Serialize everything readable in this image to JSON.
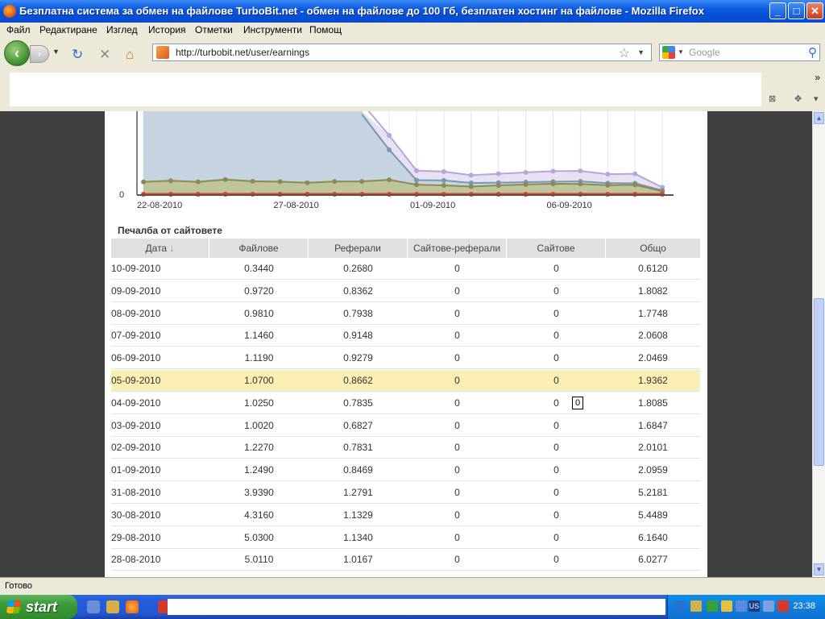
{
  "window": {
    "title": "Безплатна система за обмен на файлове TurboBit.net - обмен на файлове до 100 Гб, безплатен хостинг на файлове - Mozilla Firefox",
    "controls": {
      "minimize": "_",
      "maximize": "□",
      "close": "✕"
    }
  },
  "menu": {
    "items": [
      "Файл",
      "Редактиране",
      "Изглед",
      "История",
      "Отметки",
      "Инструменти",
      "Помощ"
    ]
  },
  "nav": {
    "back_icon": "‹",
    "forward_icon": "›",
    "url": "http://turbobit.net/user/earnings",
    "search_placeholder": "Google"
  },
  "bookmarks": {
    "overflow": "»"
  },
  "chart_data": {
    "type": "area",
    "x_tick_labels": [
      "22-08-2010",
      "27-08-2010",
      "01-09-2010",
      "06-09-2010"
    ],
    "y_tick_labels": [
      "0"
    ],
    "x": [
      "22-08-2010",
      "23-08-2010",
      "24-08-2010",
      "25-08-2010",
      "26-08-2010",
      "27-08-2010",
      "28-08-2010",
      "29-08-2010",
      "30-08-2010",
      "31-08-2010",
      "01-09-2010",
      "02-09-2010",
      "03-09-2010",
      "04-09-2010",
      "05-09-2010",
      "06-09-2010",
      "07-09-2010",
      "08-09-2010",
      "09-09-2010",
      "10-09-2010"
    ],
    "series": [
      {
        "color": "#b7a6d8",
        "values": [
          null,
          null,
          null,
          null,
          null,
          null,
          null,
          null,
          null,
          5.2181,
          2.0959,
          2.0101,
          1.6847,
          1.8085,
          1.9362,
          2.0469,
          2.0608,
          1.7748,
          1.8082,
          0.612
        ]
      },
      {
        "color": "#7a96b0",
        "values": [
          null,
          null,
          null,
          null,
          null,
          null,
          null,
          null,
          null,
          3.939,
          1.249,
          1.227,
          1.002,
          1.025,
          1.07,
          1.119,
          1.146,
          0.981,
          0.972,
          0.344
        ]
      },
      {
        "color": "#8a8a52",
        "values": [
          1.1,
          1.2,
          1.1,
          1.3,
          1.15,
          1.12,
          1.0167,
          1.134,
          1.1329,
          1.2791,
          0.8469,
          0.7831,
          0.6827,
          0.7835,
          0.8662,
          0.9279,
          0.9148,
          0.7938,
          0.8362,
          0.268
        ]
      },
      {
        "color": "#e23a2a",
        "values": [
          0,
          0,
          0,
          0,
          0,
          0,
          0,
          0,
          0,
          0,
          0,
          0,
          0,
          0,
          0,
          0,
          0,
          0,
          0,
          0
        ]
      }
    ],
    "grid": true
  },
  "table": {
    "title": "Печалба от сайтовете",
    "sort_indicator": "↓",
    "headers": [
      "Дата",
      "Файлове",
      "Реферали",
      "Сайтове-реферали",
      "Сайтове",
      "Общо"
    ],
    "rows": [
      [
        "10-09-2010",
        "0.3440",
        "0.2680",
        "0",
        "0",
        "0.6120"
      ],
      [
        "09-09-2010",
        "0.9720",
        "0.8362",
        "0",
        "0",
        "1.8082"
      ],
      [
        "08-09-2010",
        "0.9810",
        "0.7938",
        "0",
        "0",
        "1.7748"
      ],
      [
        "07-09-2010",
        "1.1460",
        "0.9148",
        "0",
        "0",
        "2.0608"
      ],
      [
        "06-09-2010",
        "1.1190",
        "0.9279",
        "0",
        "0",
        "2.0469"
      ],
      [
        "05-09-2010",
        "1.0700",
        "0.8662",
        "0",
        "0",
        "1.9362"
      ],
      [
        "04-09-2010",
        "1.0250",
        "0.7835",
        "0",
        "0",
        "1.8085"
      ],
      [
        "03-09-2010",
        "1.0020",
        "0.6827",
        "0",
        "0",
        "1.6847"
      ],
      [
        "02-09-2010",
        "1.2270",
        "0.7831",
        "0",
        "0",
        "2.0101"
      ],
      [
        "01-09-2010",
        "1.2490",
        "0.8469",
        "0",
        "0",
        "2.0959"
      ],
      [
        "31-08-2010",
        "3.9390",
        "1.2791",
        "0",
        "0",
        "5.2181"
      ],
      [
        "30-08-2010",
        "4.3160",
        "1.1329",
        "0",
        "0",
        "5.4489"
      ],
      [
        "29-08-2010",
        "5.0300",
        "1.1340",
        "0",
        "0",
        "6.1640"
      ],
      [
        "28-08-2010",
        "5.0110",
        "1.0167",
        "0",
        "0",
        "6.0277"
      ]
    ],
    "highlight_row": 5,
    "tooltip": "0"
  },
  "status": {
    "text": "Готово"
  },
  "taskbar": {
    "start_label": "start",
    "clock": "23:38",
    "lang": "US"
  }
}
